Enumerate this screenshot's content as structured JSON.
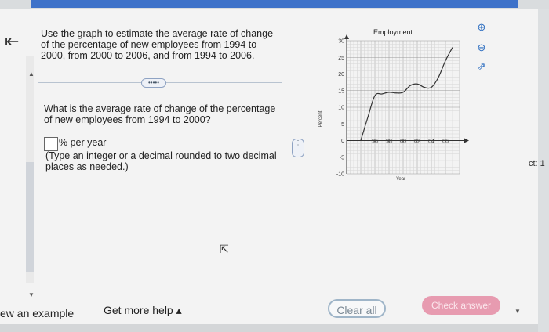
{
  "question": {
    "main": "Use the graph to estimate the average rate of change of the percentage of new employees from 1994 to 2000, from 2000 to 2006, and from 1994 to 2006.",
    "sub": "What is the average rate of change of the percentage of new employees from 1994 to 2000?",
    "unit": "% per year",
    "hint": "(Type an integer or a decimal rounded to two decimal places as needed.)",
    "more_label": "•••••"
  },
  "footer": {
    "example": "ew an example",
    "help": "Get more help ▴"
  },
  "buttons": {
    "clear": "Clear all",
    "check": "Check answer"
  },
  "side_text": "ct: 1",
  "chart_data": {
    "type": "line",
    "title": "Employment",
    "xlabel": "Year",
    "ylabel": "Percent",
    "x_ticks": [
      "96",
      "98",
      "00",
      "02",
      "04",
      "06"
    ],
    "y_ticks": [
      -10,
      -5,
      0,
      5,
      10,
      15,
      20,
      25,
      30
    ],
    "xlim": [
      1992,
      2008
    ],
    "ylim": [
      -10,
      30
    ],
    "series": [
      {
        "x": [
          1994,
          1995,
          1996,
          1997,
          1998,
          1999,
          2000,
          2001,
          2002,
          2003,
          2004,
          2005,
          2006,
          2007
        ],
        "values": [
          0,
          7,
          13.5,
          14,
          14.5,
          14.3,
          14.5,
          16.5,
          17,
          16,
          16,
          19,
          24,
          28
        ]
      }
    ]
  }
}
